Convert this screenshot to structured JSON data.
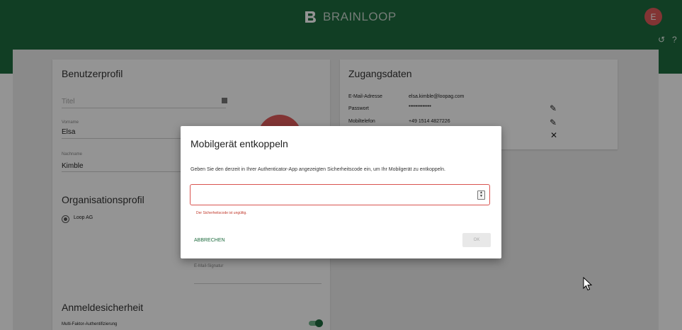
{
  "header": {
    "brand_name": "BRAINLOOP",
    "avatar_initial": "E",
    "history_icon": "history-icon",
    "help_icon": "help-icon",
    "brand_color": "#1e6b3e"
  },
  "profile": {
    "title": "Benutzerprofil",
    "titel_placeholder": "Titel",
    "vorname_label": "Vorname",
    "vorname_value": "Elsa",
    "nachname_label": "Nachname",
    "nachname_value": "Kimble"
  },
  "organisation": {
    "title": "Organisationsprofil",
    "option": "Loop AG",
    "signature_label": "E-Mail-Signatur"
  },
  "security": {
    "title": "Anmeldesicherheit",
    "mfa_label": "Multi-Faktor-Authentifizierung"
  },
  "credentials": {
    "title": "Zugangsdaten",
    "email_label": "E-Mail-Adresse",
    "email_value": "elsa.kimble@loopag.com",
    "password_label": "Passwort",
    "password_value": "•••••••••••••",
    "mobile_label": "Mobiltelefon",
    "mobile_value": "+49 1514 4827226"
  },
  "dialog": {
    "title": "Mobilgerät entkoppeln",
    "description": "Geben Sie den derzeit in Ihrer Authenticator-App angezeigten Sicherheitscode ein, um Ihr Mobilgerät zu entkoppeln.",
    "error": "Der Sicherheitscode ist ungültig.",
    "cancel_label": "ABBRECHEN",
    "ok_label": "OK",
    "error_color": "#d9534f"
  }
}
